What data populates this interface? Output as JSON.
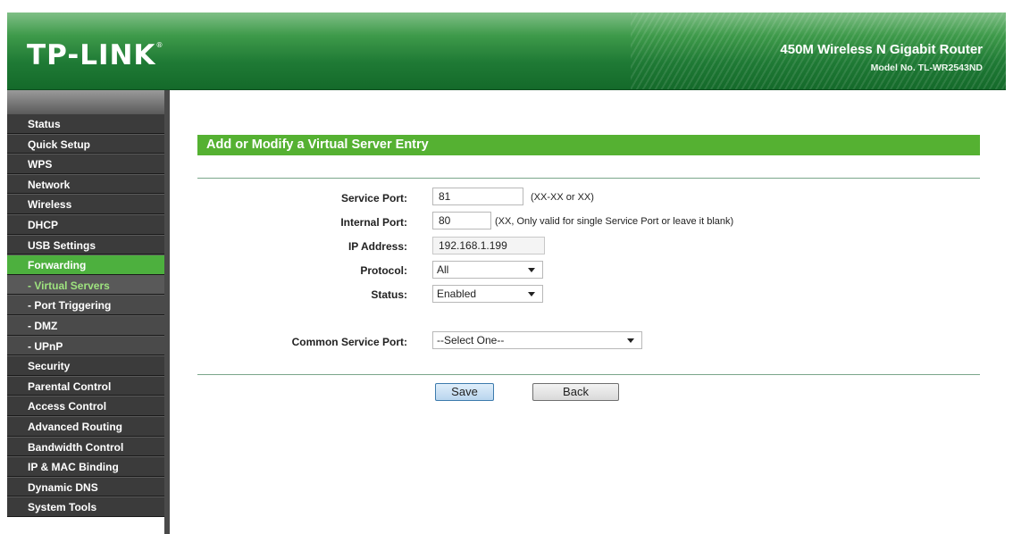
{
  "header": {
    "logo": "TP-LINK",
    "logo_mark": "®",
    "product_name": "450M Wireless N Gigabit Router",
    "model_no": "Model No. TL-WR2543ND"
  },
  "sidebar": {
    "items": [
      {
        "label": "Status"
      },
      {
        "label": "Quick Setup"
      },
      {
        "label": "WPS"
      },
      {
        "label": "Network"
      },
      {
        "label": "Wireless"
      },
      {
        "label": "DHCP"
      },
      {
        "label": "USB Settings"
      },
      {
        "label": "Forwarding"
      },
      {
        "label": "- Virtual Servers"
      },
      {
        "label": "- Port Triggering"
      },
      {
        "label": "- DMZ"
      },
      {
        "label": "- UPnP"
      },
      {
        "label": "Security"
      },
      {
        "label": "Parental Control"
      },
      {
        "label": "Access Control"
      },
      {
        "label": "Advanced Routing"
      },
      {
        "label": "Bandwidth Control"
      },
      {
        "label": "IP & MAC Binding"
      },
      {
        "label": "Dynamic DNS"
      },
      {
        "label": "System Tools"
      }
    ],
    "active": "Forwarding",
    "active_sub": "- Virtual Servers"
  },
  "form": {
    "title": "Add or Modify a Virtual Server Entry",
    "service_port": {
      "label": "Service Port:",
      "value": "81",
      "hint": "(XX-XX or XX)"
    },
    "internal_port": {
      "label": "Internal Port:",
      "value": "80",
      "hint": "(XX, Only valid for single Service Port or leave it blank)"
    },
    "ip_address": {
      "label": "IP Address:",
      "value": "192.168.1.199"
    },
    "protocol": {
      "label": "Protocol:",
      "value": "All"
    },
    "status": {
      "label": "Status:",
      "value": "Enabled"
    },
    "common_service_port": {
      "label": "Common Service Port:",
      "value": "--Select One--"
    },
    "save_label": "Save",
    "back_label": "Back"
  },
  "colors": {
    "header_green": "#1f7a35",
    "title_bar_green": "#55b132",
    "sidebar_bg": "#3b3b3b",
    "sidebar_active": "#4db03e"
  }
}
